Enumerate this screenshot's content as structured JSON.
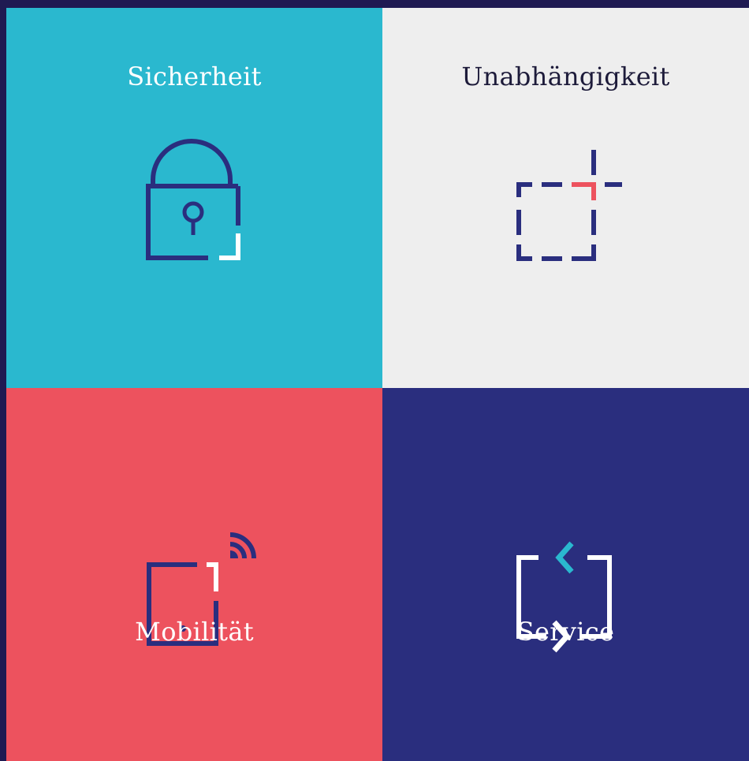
{
  "tiles": [
    {
      "title": "Sicherheit",
      "icon": "padlock-icon",
      "background": "#2ab8cf",
      "text_color": "#ffffff"
    },
    {
      "title": "Unabhängigkeit",
      "icon": "dashed-square-plus-icon",
      "background": "#eeeeee",
      "text_color": "#1d1b3a"
    },
    {
      "title": "Mobilität",
      "icon": "mobile-signal-icon",
      "background": "#ed525e",
      "text_color": "#ffffff"
    },
    {
      "title": "Service",
      "icon": "exchange-arrows-icon",
      "background": "#2a2e7e",
      "text_color": "#ffffff"
    }
  ],
  "colors": {
    "navy": "#2a2e7e",
    "white": "#ffffff",
    "red": "#ed525e",
    "cyan": "#2ab8cf",
    "border": "#1f1a52"
  }
}
